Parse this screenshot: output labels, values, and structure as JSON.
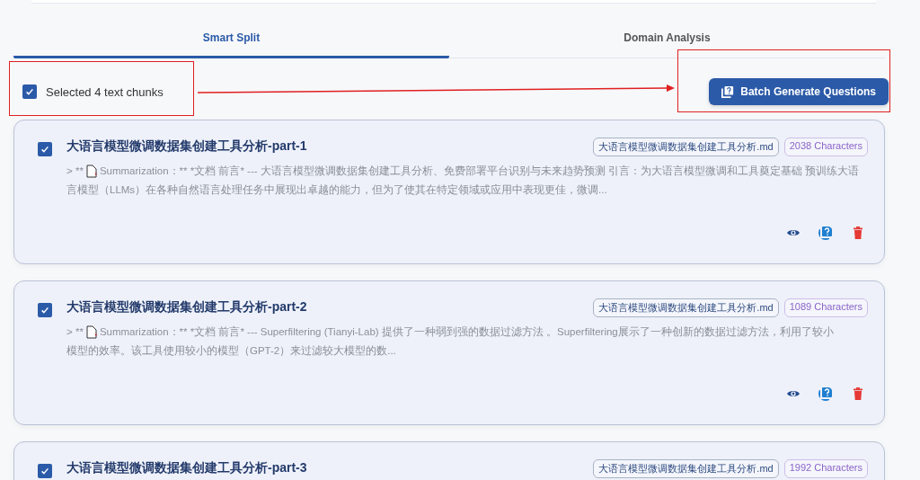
{
  "tabs": [
    {
      "label": "Smart Split",
      "selected": true
    },
    {
      "label": "Domain Analysis",
      "selected": false
    }
  ],
  "selection": {
    "label": "Selected 4 text chunks",
    "checked": true
  },
  "batch_button": {
    "label": "Batch Generate Questions"
  },
  "chunks": [
    {
      "title": "大语言模型微调数据集创建工具分析-part-1",
      "checked": true,
      "file": "大语言模型微调数据集创建工具分析.md",
      "count": "2038 Characters",
      "summary_prefix": "> **",
      "summary_lines": [
        "Summarization：** *文档 前言* --- 大语言模型微调数据集创建工具分析、免费部署平台识别与未来趋势预测 引言：为大语言模型微调和工具奠定基础 预训练大语",
        "言模型（LLMs）在各种自然语言处理任务中展现出卓越的能力，但为了使其在特定领域或应用中表现更佳，微调..."
      ]
    },
    {
      "title": "大语言模型微调数据集创建工具分析-part-2",
      "checked": true,
      "file": "大语言模型微调数据集创建工具分析.md",
      "count": "1089 Characters",
      "summary_prefix": "> **",
      "summary_lines": [
        "Summarization：** *文档 前言* --- Superfiltering (Tianyi-Lab) 提供了一种弱到强的数据过滤方法 。Superfiltering展示了一种创新的数据过滤方法，利用了较小",
        "模型的效率。该工具使用较小的模型（GPT-2）来过滤较大模型的数..."
      ]
    },
    {
      "title": "大语言模型微调数据集创建工具分析-part-3",
      "checked": true,
      "file": "大语言模型微调数据集创建工具分析.md",
      "count": "1992 Characters"
    }
  ]
}
